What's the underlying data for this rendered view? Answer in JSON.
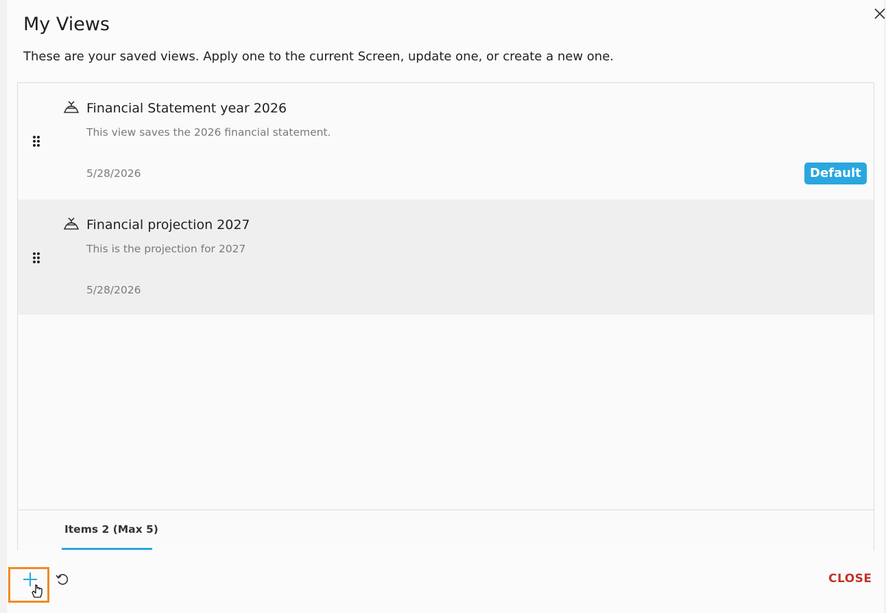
{
  "dialog": {
    "title": "My Views",
    "subtitle": "These are your saved views. Apply one to the current Screen, update one, or create a new one.",
    "close_icon": "close-icon"
  },
  "views": [
    {
      "name": "Financial Statement year 2026",
      "description": "This view saves the 2026 financial statement.",
      "date": "5/28/2026",
      "badge": "Default",
      "icon": "view-icon"
    },
    {
      "name": "Financial projection 2027",
      "description": "This is the projection for 2027",
      "date": "5/28/2026",
      "icon": "view-icon"
    }
  ],
  "footer": {
    "items_count": "Items 2 (Max 5)"
  },
  "actions": {
    "add_icon": "plus-icon",
    "reset_icon": "reset-icon",
    "close_label": "CLOSE"
  },
  "colors": {
    "accent": "#2aa7df",
    "close": "#c2332b",
    "highlight": "#f08a24"
  }
}
